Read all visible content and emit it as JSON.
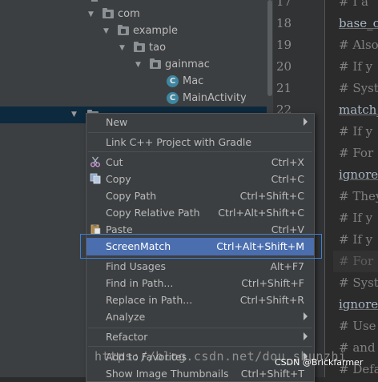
{
  "tree": {
    "items": [
      {
        "label": "com",
        "kind": "package"
      },
      {
        "label": "example",
        "kind": "package"
      },
      {
        "label": "tao",
        "kind": "package"
      },
      {
        "label": "gainmac",
        "kind": "package"
      },
      {
        "label": "Mac",
        "kind": "class",
        "icon": "class-icon"
      },
      {
        "label": "MainActivity",
        "kind": "class",
        "icon": "class-icon"
      }
    ],
    "class_glyph": "C"
  },
  "editor": {
    "line_numbers": [
      "17",
      "18",
      "19",
      "20",
      "21",
      "22"
    ],
    "code_lines": [
      "# I a",
      "base_c",
      "# Also",
      "# If y",
      "# Syst",
      "match_",
      "# If y",
      "# For",
      "ignore",
      "# They",
      "# If y",
      "# If y",
      "# For",
      "# Syst",
      "ignore",
      "# Use",
      "# and",
      "# Defa"
    ]
  },
  "context_menu": {
    "items": [
      {
        "id": "new",
        "label": "New",
        "shortcut": "",
        "submenu": true
      },
      {
        "id": "link-cpp",
        "label": "Link C++ Project with Gradle",
        "shortcut": ""
      },
      {
        "id": "cut",
        "label": "Cut",
        "shortcut": "Ctrl+X",
        "icon": "scissors-icon"
      },
      {
        "id": "copy",
        "label": "Copy",
        "shortcut": "Ctrl+C",
        "icon": "copy-icon"
      },
      {
        "id": "copy-path",
        "label": "Copy Path",
        "shortcut": "Ctrl+Shift+C"
      },
      {
        "id": "copy-relative-path",
        "label": "Copy Relative Path",
        "shortcut": "Ctrl+Alt+Shift+C"
      },
      {
        "id": "paste",
        "label": "Paste",
        "shortcut": "Ctrl+V",
        "icon": "paste-icon"
      },
      {
        "id": "screenmatch",
        "label": "ScreenMatch",
        "shortcut": "Ctrl+Alt+Shift+M",
        "active": true
      },
      {
        "id": "find-usages",
        "label": "Find Usages",
        "shortcut": "Alt+F7"
      },
      {
        "id": "find-in-path",
        "label": "Find in Path...",
        "shortcut": "Ctrl+Shift+F"
      },
      {
        "id": "replace-in-path",
        "label": "Replace in Path...",
        "shortcut": "Ctrl+Shift+R"
      },
      {
        "id": "analyze",
        "label": "Analyze",
        "shortcut": "",
        "submenu": true
      },
      {
        "id": "refactor",
        "label": "Refactor",
        "shortcut": "",
        "submenu": true
      },
      {
        "id": "add-to-favorites",
        "label": "Add to Favorites",
        "shortcut": "",
        "submenu": true
      },
      {
        "id": "show-image-thumbnails",
        "label": "Show Image Thumbnails",
        "shortcut": "Ctrl+Shift+T"
      }
    ]
  },
  "watermark": {
    "url": "https://blog.csdn.net/dou_shunzhi",
    "site": "CSDN @Brickfarmer"
  },
  "colors": {
    "menu_bg": "#3c3f41",
    "active_item": "#4b6eaf",
    "focus_border": "#3d7fd6",
    "selected_row": "#0d293e"
  }
}
